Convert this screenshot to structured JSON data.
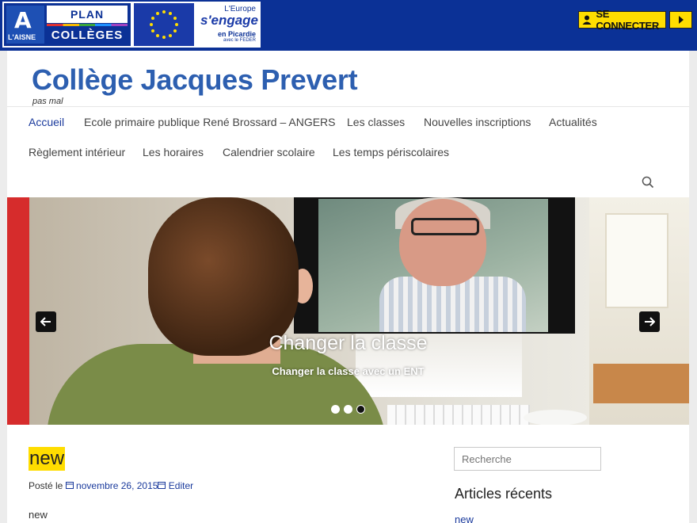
{
  "topbar": {
    "logos": {
      "aisne": "L'AISNE",
      "plan": "PLAN",
      "colleges": "COLLÈGES",
      "europe": "L'Europe",
      "engage": "s'engage",
      "picardie": "en Picardie",
      "feder": "avec le FEDER"
    },
    "connect_label": "SE CONNECTER",
    "colors": {
      "bar": "#0b3196",
      "button": "#ffdd00"
    }
  },
  "site": {
    "title": "Collège Jacques Prevert",
    "description": "pas mal"
  },
  "nav": {
    "items": [
      {
        "label": "Accueil"
      },
      {
        "label": "Ecole primaire publique René Brossard – ANGERS"
      },
      {
        "label": "Les classes"
      },
      {
        "label": "Nouvelles inscriptions"
      },
      {
        "label": "Actualités"
      },
      {
        "label": "Règlement intérieur"
      },
      {
        "label": "Les horaires"
      },
      {
        "label": "Calendrier scolaire"
      },
      {
        "label": "Les temps périscolaires"
      }
    ],
    "active_color": "#1a3a9c"
  },
  "slider": {
    "caption": "Changer la classe",
    "subcaption": "Changer la classe avec un ENT",
    "slide_count": 3,
    "active_slide": 3
  },
  "post": {
    "title": "new",
    "meta_prefix": "Posté le",
    "date": "novembre 26, 2015",
    "edit": "Editer",
    "body": "new"
  },
  "sidebar": {
    "search_placeholder": "Recherche",
    "recent_title": "Articles récents",
    "recent_items": [
      {
        "label": "new"
      }
    ]
  }
}
